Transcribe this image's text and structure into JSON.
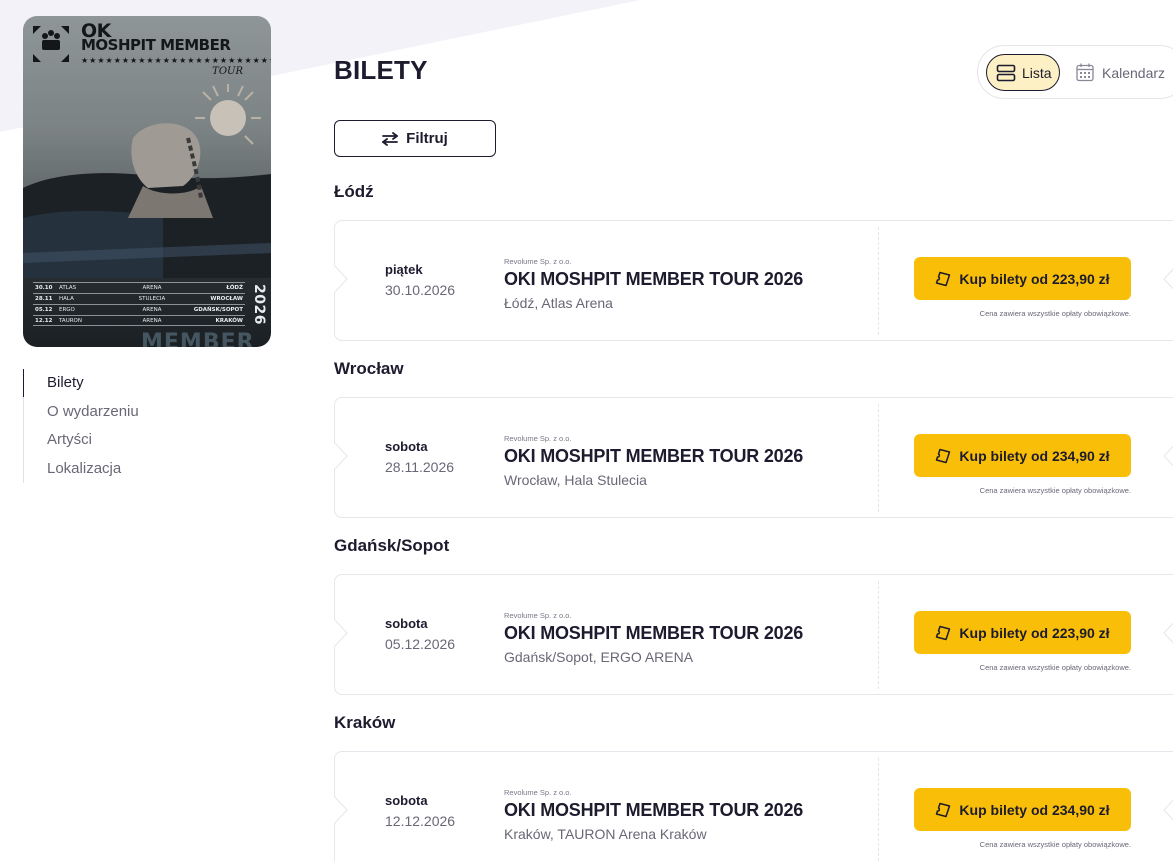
{
  "poster": {
    "brand_line1": "OK",
    "brand_line2": "MOSHPIT MEMBER",
    "stars": "★★★★★★★★★★★★★★★★★★★★★★★★★★★★★★★★★★★★★★★★★★★★★★★★",
    "tour_script": "TOUR",
    "year": "2026",
    "ghost_text": "MEMBER",
    "rows": [
      {
        "date": "30.10",
        "venue": "ATLAS",
        "venue2": "ARENA",
        "city": "ŁÓDŹ"
      },
      {
        "date": "28.11",
        "venue": "HALA",
        "venue2": "STULECIA",
        "city": "WROCŁAW"
      },
      {
        "date": "05.12",
        "venue": "ERGO",
        "venue2": "ARENA",
        "city": "GDAŃSK/SOPOT"
      },
      {
        "date": "12.12",
        "venue": "TAURON",
        "venue2": "ARENA",
        "city": "KRAKÓW"
      }
    ]
  },
  "nav": {
    "items": [
      {
        "label": "Bilety",
        "active": true
      },
      {
        "label": "O wydarzeniu",
        "active": false
      },
      {
        "label": "Artyści",
        "active": false
      },
      {
        "label": "Lokalizacja",
        "active": false
      }
    ]
  },
  "header": {
    "title": "BILETY",
    "view_list": "Lista",
    "view_calendar": "Kalendarz",
    "filter_label": "Filtruj"
  },
  "colors": {
    "accent_yellow": "#f9bf08",
    "toggle_active_bg": "#fdf0c4",
    "text_dark": "#1d1b2e",
    "text_muted": "#6a6777"
  },
  "events": [
    {
      "city": "Łódź",
      "weekday": "piątek",
      "date": "30.10.2026",
      "organizer": "Revolume Sp. z o.o.",
      "title": "OKI MOSHPIT MEMBER TOUR 2026",
      "venue": "Łódź, Atlas Arena",
      "buy_label": "Kup bilety od 223,90 zł",
      "price_note": "Cena zawiera wszystkie opłaty obowiązkowe."
    },
    {
      "city": "Wrocław",
      "weekday": "sobota",
      "date": "28.11.2026",
      "organizer": "Revolume Sp. z o.o.",
      "title": "OKI MOSHPIT MEMBER TOUR 2026",
      "venue": "Wrocław, Hala Stulecia",
      "buy_label": "Kup bilety od 234,90 zł",
      "price_note": "Cena zawiera wszystkie opłaty obowiązkowe."
    },
    {
      "city": "Gdańsk/Sopot",
      "weekday": "sobota",
      "date": "05.12.2026",
      "organizer": "Revolume Sp. z o.o.",
      "title": "OKI MOSHPIT MEMBER TOUR 2026",
      "venue": "Gdańsk/Sopot, ERGO ARENA",
      "buy_label": "Kup bilety od 223,90 zł",
      "price_note": "Cena zawiera wszystkie opłaty obowiązkowe."
    },
    {
      "city": "Kraków",
      "weekday": "sobota",
      "date": "12.12.2026",
      "organizer": "Revolume Sp. z o.o.",
      "title": "OKI MOSHPIT MEMBER TOUR 2026",
      "venue": "Kraków, TAURON Arena Kraków",
      "buy_label": "Kup bilety od 234,90 zł",
      "price_note": "Cena zawiera wszystkie opłaty obowiązkowe."
    }
  ]
}
